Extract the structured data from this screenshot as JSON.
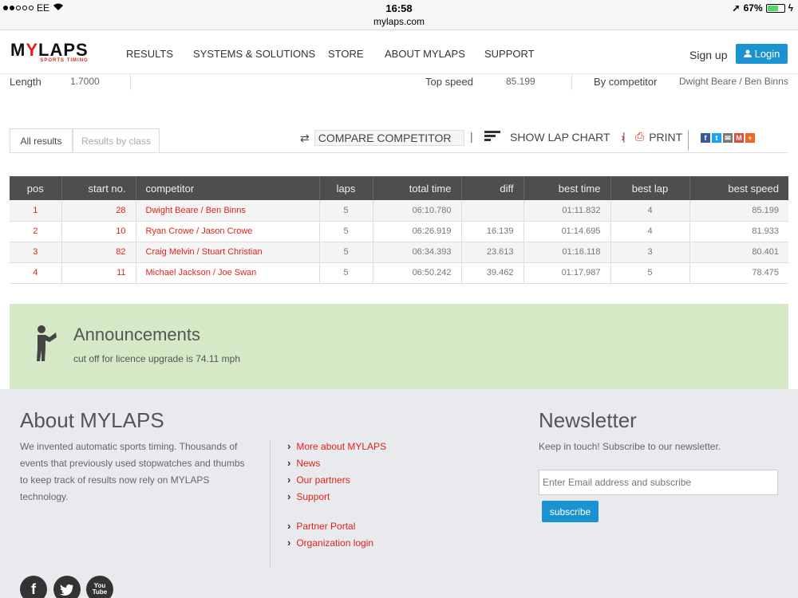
{
  "status_bar": {
    "carrier": "EE",
    "time": "16:58",
    "url": "mylaps.com",
    "battery": "67%",
    "battery_level": 0.67
  },
  "nav": {
    "logo": "MYLAPS",
    "logo_sub": "SPORTS TIMING",
    "items": [
      "RESULTS",
      "SYSTEMS & SOLUTIONS",
      "STORE",
      "ABOUT MYLAPS",
      "SUPPORT"
    ],
    "signup": "Sign up",
    "login": "Login"
  },
  "event_meta": {
    "length_label": "Length",
    "length_value": "1.7000",
    "top_speed_label": "Top speed",
    "top_speed_value": "85.199",
    "by_label": "By competitor",
    "by_value": "Dwight Beare / Ben Binns"
  },
  "tabs": [
    "All results",
    "Results by class"
  ],
  "toolbar": {
    "compare": "COMPARE COMPETITOR",
    "lap_chart": "SHOW LAP CHART",
    "print": "PRINT"
  },
  "table": {
    "headers": [
      "pos",
      "start no.",
      "competitor",
      "laps",
      "total time",
      "diff",
      "best time",
      "best lap",
      "best speed"
    ],
    "rows": [
      [
        "1",
        "28",
        "Dwight Beare / Ben Binns",
        "5",
        "06:10.780",
        "",
        "01:11.832",
        "4",
        "85.199"
      ],
      [
        "2",
        "10",
        "Ryan Crowe / Jason Crowe",
        "5",
        "06:26.919",
        "16.139",
        "01:14.695",
        "4",
        "81.933"
      ],
      [
        "3",
        "82",
        "Craig Melvin / Stuart Christian",
        "5",
        "06:34.393",
        "23.613",
        "01:16.118",
        "3",
        "80.401"
      ],
      [
        "4",
        "11",
        "Michael Jackson / Joe Swan",
        "5",
        "06:50.242",
        "39.462",
        "01:17.987",
        "5",
        "78.475"
      ]
    ]
  },
  "announcements": {
    "title": "Announcements",
    "text": "cut off for licence upgrade is 74.11 mph"
  },
  "footer": {
    "about_title": "About MYLAPS",
    "about_text": "We invented automatic sports timing. Thousands of events that previously used stopwatches and thumbs to keep track of results now rely on MYLAPS technology.",
    "links": [
      "More about MYLAPS",
      "News",
      "Our partners",
      "Support"
    ],
    "links2": [
      "Partner Portal",
      "Organization login"
    ],
    "newsletter_title": "Newsletter",
    "newsletter_text": "Keep in touch! Subscribe to our newsletter.",
    "email_placeholder": "Enter Email address and subscribe",
    "subscribe": "subscribe",
    "youtube_label": "You Tube"
  },
  "colors": {
    "brand_red": "#e2231a",
    "login_blue": "#1c93d1",
    "announce_green": "#d6e9c6",
    "table_header": "#4e4e4e"
  }
}
